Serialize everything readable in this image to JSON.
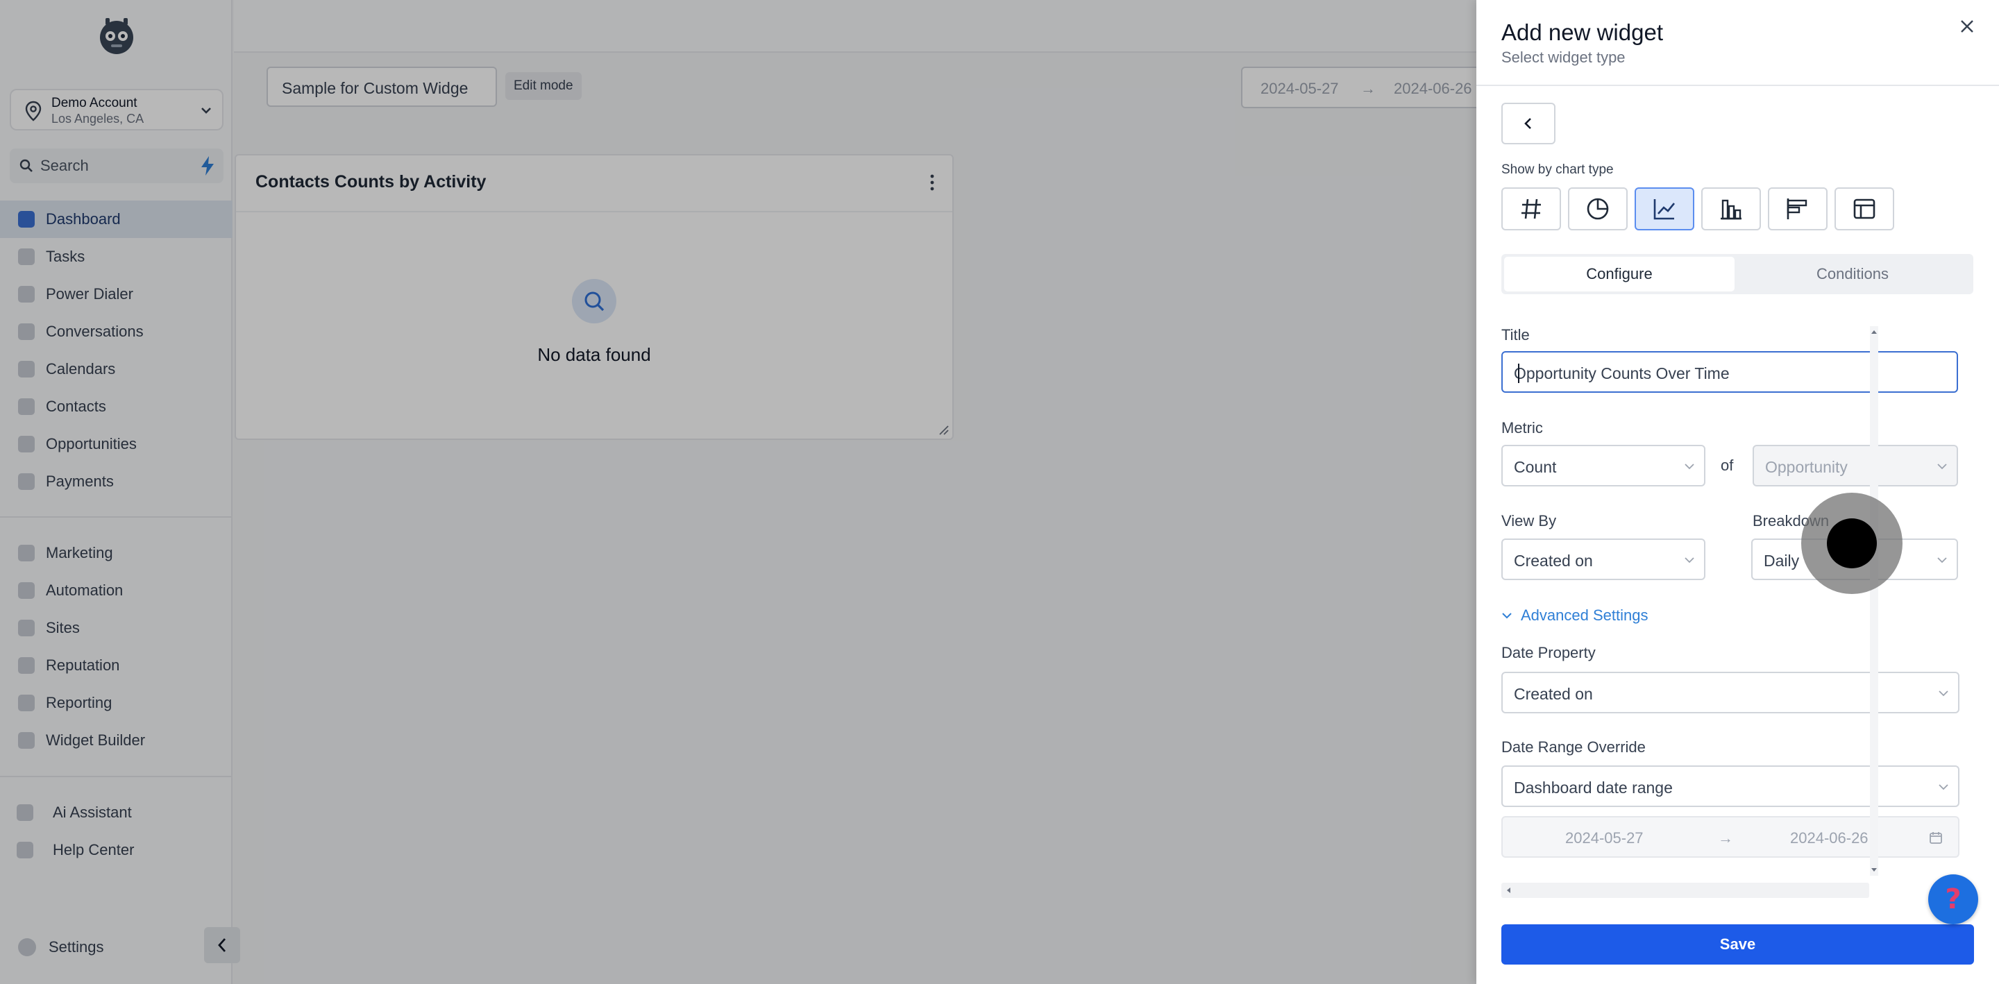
{
  "sidebar": {
    "account": {
      "name": "Demo Account",
      "location": "Los Angeles, CA"
    },
    "search_placeholder": "Search",
    "primary_items": [
      {
        "label": "Dashboard",
        "icon": "dashboard-icon",
        "active": true
      },
      {
        "label": "Tasks",
        "icon": "check-icon"
      },
      {
        "label": "Power Dialer",
        "icon": "lightning-icon"
      },
      {
        "label": "Conversations",
        "icon": "chat-icon"
      },
      {
        "label": "Calendars",
        "icon": "calendar-icon"
      },
      {
        "label": "Contacts",
        "icon": "person-icon"
      },
      {
        "label": "Opportunities",
        "icon": "funnel-icon"
      },
      {
        "label": "Payments",
        "icon": "card-icon"
      }
    ],
    "secondary_items": [
      {
        "label": "Marketing",
        "icon": "megaphone-icon"
      },
      {
        "label": "Automation",
        "icon": "gear-icon"
      },
      {
        "label": "Sites",
        "icon": "globe-icon"
      },
      {
        "label": "Reputation",
        "icon": "star-icon"
      },
      {
        "label": "Reporting",
        "icon": "pie-icon"
      },
      {
        "label": "Widget Builder",
        "icon": "widget-icon"
      }
    ],
    "tertiary_items": [
      {
        "label": "Ai Assistant",
        "icon": "robot-icon"
      },
      {
        "label": "Help Center",
        "icon": "question-icon"
      }
    ],
    "settings_label": "Settings"
  },
  "dashboard": {
    "name": "Sample for Custom Widge",
    "edit_mode_label": "Edit mode",
    "date_start": "2024-05-27",
    "date_arrow": "→",
    "date_end": "2024-06-26",
    "widget": {
      "title": "Contacts Counts by Activity",
      "empty_text": "No data found"
    }
  },
  "drawer": {
    "title": "Add new widget",
    "subtitle": "Select widget type",
    "chart_type_label": "Show by chart type",
    "chart_types": [
      "number-icon",
      "pie-chart-icon",
      "line-chart-icon",
      "bar-chart-icon",
      "horizontal-bar-icon",
      "table-icon"
    ],
    "active_chart_type": "line-chart-icon",
    "tabs": {
      "configure": "Configure",
      "conditions": "Conditions"
    },
    "form": {
      "title_label": "Title",
      "title_value": "Opportunity Counts Over Time",
      "metric_label": "Metric",
      "metric_value": "Count",
      "of_label": "of",
      "metric_object": "Opportunity",
      "view_by_label": "View By",
      "view_by_value": "Created on",
      "breakdown_label": "Breakdown",
      "breakdown_value": "Daily",
      "advanced_label": "Advanced Settings",
      "date_property_label": "Date Property",
      "date_property_value": "Created on",
      "date_range_label": "Date Range Override",
      "date_range_value": "Dashboard date range",
      "range_start": "2024-05-27",
      "range_arrow": "→",
      "range_end": "2024-06-26"
    },
    "save_label": "Save",
    "help_glyph": "?"
  },
  "colors": {
    "primary": "#1d5be8",
    "link": "#2f7fd6",
    "active_nav": "#dde5ef"
  }
}
